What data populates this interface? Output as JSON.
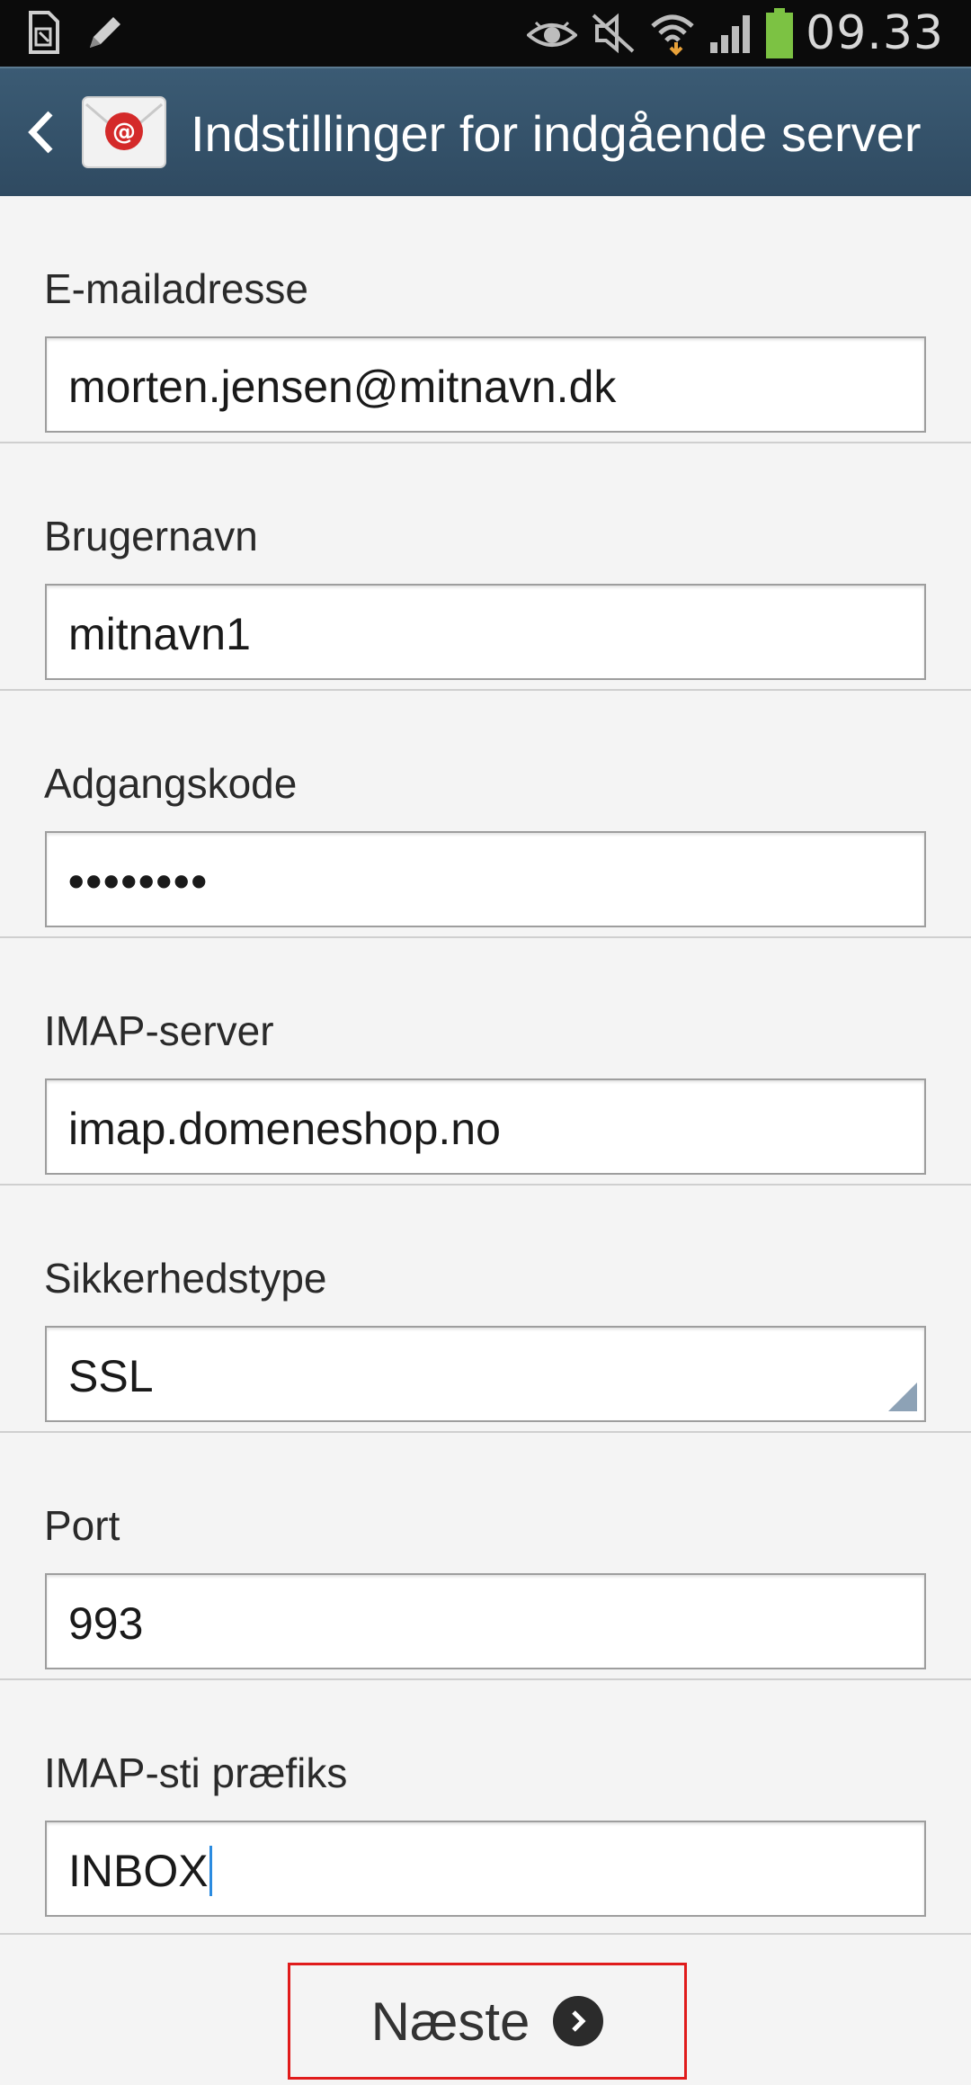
{
  "status_bar": {
    "time": "09.33",
    "icons": [
      "sim-card-icon",
      "edit-icon",
      "eye-icon",
      "mute-icon",
      "wifi-icon",
      "signal-icon",
      "battery-icon"
    ],
    "battery_color": "#7cc243"
  },
  "header": {
    "title": "Indstillinger for indgående server",
    "back_icon": "chevron-left-icon",
    "app_icon": "email-app-icon",
    "background": "#34526a"
  },
  "form": {
    "email": {
      "label": "E-mailadresse",
      "value": "morten.jensen@mitnavn.dk"
    },
    "username": {
      "label": "Brugernavn",
      "value": "mitnavn1"
    },
    "password": {
      "label": "Adgangskode",
      "value": "••••••••"
    },
    "imap_server": {
      "label": "IMAP-server",
      "value": "imap.domeneshop.no"
    },
    "security_type": {
      "label": "Sikkerhedstype",
      "value": "SSL"
    },
    "port": {
      "label": "Port",
      "value": "993"
    },
    "imap_path_prefix": {
      "label": "IMAP-sti præfiks",
      "value": "INBOX"
    }
  },
  "footer": {
    "next_label": "Næste",
    "next_icon": "chevron-right-circle-icon",
    "highlight_color": "#e01b1b"
  }
}
